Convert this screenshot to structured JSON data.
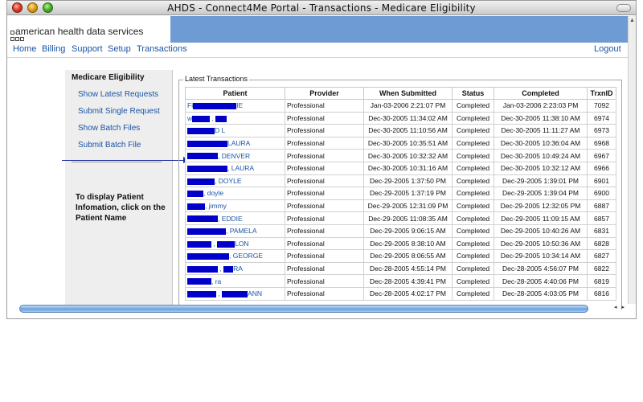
{
  "window": {
    "title": "AHDS - Connect4Me Portal - Transactions - Medicare Eligibility"
  },
  "header": {
    "logo_text": "american health data services"
  },
  "nav": {
    "home": "Home",
    "billing": "Billing",
    "support": "Support",
    "setup": "Setup",
    "transactions": "Transactions",
    "logout": "Logout"
  },
  "sidebar": {
    "title": "Medicare Eligibility",
    "links": [
      {
        "label": "Show Latest Requests"
      },
      {
        "label": "Submit Single Request"
      },
      {
        "label": "Show Batch Files"
      },
      {
        "label": "Submit Batch File"
      }
    ],
    "callout": "To display Patient Infomation, click on the Patient Name"
  },
  "transactions": {
    "legend": "Latest Transactions",
    "columns": [
      "Patient",
      "Provider",
      "When Submitted",
      "Status",
      "Completed",
      "TrxnID"
    ],
    "rows": [
      {
        "patient_prefix": "Fi",
        "patient_suffix": "IE",
        "provider": "Professional",
        "submitted": "Jan-03-2006 2:21:07 PM",
        "status": "Completed",
        "completed": "Jan-03-2006 2:23:03 PM",
        "id": "7092"
      },
      {
        "patient_prefix": "w",
        "patient_suffix": "",
        "provider": "Professional",
        "submitted": "Dec-30-2005 11:34:02 AM",
        "status": "Completed",
        "completed": "Dec-30-2005 11:38:10 AM",
        "id": "6974"
      },
      {
        "patient_prefix": "",
        "patient_suffix": "D L",
        "provider": "Professional",
        "submitted": "Dec-30-2005 11:10:56 AM",
        "status": "Completed",
        "completed": "Dec-30-2005 11:11:27 AM",
        "id": "6973"
      },
      {
        "patient_prefix": "",
        "patient_suffix": "LAURA",
        "provider": "Professional",
        "submitted": "Dec-30-2005 10:35:51 AM",
        "status": "Completed",
        "completed": "Dec-30-2005 10:36:04 AM",
        "id": "6968"
      },
      {
        "patient_prefix": "",
        "patient_suffix": ", DENVER",
        "provider": "Professional",
        "submitted": "Dec-30-2005 10:32:32 AM",
        "status": "Completed",
        "completed": "Dec-30-2005 10:49:24 AM",
        "id": "6967"
      },
      {
        "patient_prefix": "",
        "patient_suffix": ", LAURA",
        "provider": "Professional",
        "submitted": "Dec-30-2005 10:31:16 AM",
        "status": "Completed",
        "completed": "Dec-30-2005 10:32:12 AM",
        "id": "6966"
      },
      {
        "patient_prefix": "",
        "patient_suffix": ", DOYLE",
        "provider": "Professional",
        "submitted": "Dec-29-2005 1:37:50 PM",
        "status": "Completed",
        "completed": "Dec-29-2005 1:39:01 PM",
        "id": "6901"
      },
      {
        "patient_prefix": "",
        "patient_suffix": ", doyle",
        "provider": "Professional",
        "submitted": "Dec-29-2005 1:37:19 PM",
        "status": "Completed",
        "completed": "Dec-29-2005 1:39:04 PM",
        "id": "6900"
      },
      {
        "patient_prefix": "",
        "patient_suffix": ", jimmy",
        "provider": "Professional",
        "submitted": "Dec-29-2005 12:31:09 PM",
        "status": "Completed",
        "completed": "Dec-29-2005 12:32:05 PM",
        "id": "6887"
      },
      {
        "patient_prefix": "",
        "patient_suffix": ", EDDIE",
        "provider": "Professional",
        "submitted": "Dec-29-2005 11:08:35 AM",
        "status": "Completed",
        "completed": "Dec-29-2005 11:09:15 AM",
        "id": "6857"
      },
      {
        "patient_prefix": "",
        "patient_suffix": ", PAMELA",
        "provider": "Professional",
        "submitted": "Dec-29-2005 9:06:15 AM",
        "status": "Completed",
        "completed": "Dec-29-2005 10:40:26 AM",
        "id": "6831"
      },
      {
        "patient_prefix": "",
        "patient_suffix": "LON",
        "provider": "Professional",
        "submitted": "Dec-29-2005 8:38:10 AM",
        "status": "Completed",
        "completed": "Dec-29-2005 10:50:36 AM",
        "id": "6828"
      },
      {
        "patient_prefix": "",
        "patient_suffix": ", GEORGE",
        "provider": "Professional",
        "submitted": "Dec-29-2005 8:06:55 AM",
        "status": "Completed",
        "completed": "Dec-29-2005 10:34:14 AM",
        "id": "6827"
      },
      {
        "patient_prefix": "",
        "patient_suffix": "RA",
        "provider": "Professional",
        "submitted": "Dec-28-2005 4:55:14 PM",
        "status": "Completed",
        "completed": "Dec-28-2005 4:56:07 PM",
        "id": "6822"
      },
      {
        "patient_prefix": "",
        "patient_suffix": ", ra",
        "provider": "Professional",
        "submitted": "Dec-28-2005 4:39:41 PM",
        "status": "Completed",
        "completed": "Dec-28-2005 4:40:06 PM",
        "id": "6819"
      },
      {
        "patient_prefix": "",
        "patient_suffix": "ANN",
        "provider": "Professional",
        "submitted": "Dec-28-2005 4:02:17 PM",
        "status": "Completed",
        "completed": "Dec-28-2005 4:03:05 PM",
        "id": "6816"
      }
    ]
  },
  "colors": {
    "banner": "#6e9bd3",
    "link": "#1a55a5",
    "redaction": "#0000c8"
  }
}
